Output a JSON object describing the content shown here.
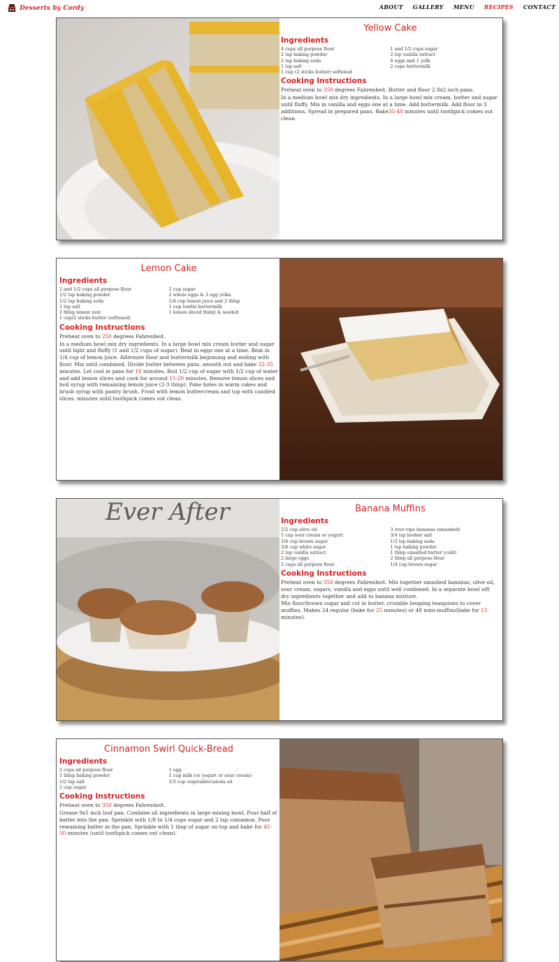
{
  "site": {
    "brand": "Desserts by Cordy",
    "brand_icon": "cake-icon"
  },
  "nav": [
    {
      "label": "ABOUT",
      "active": false
    },
    {
      "label": "GALLERY",
      "active": false
    },
    {
      "label": "MENU",
      "active": false
    },
    {
      "label": "RECIPES",
      "active": true
    },
    {
      "label": "CONTACT",
      "active": false
    }
  ],
  "colors": {
    "accent": "#d32222",
    "text": "#333333",
    "border": "#555555"
  },
  "ui": {
    "ingredients_heading": "Ingredients",
    "instructions_heading": "Cooking Instructions"
  },
  "recipes": [
    {
      "title": "Yellow Cake",
      "ingredients_col1": [
        "4 cups all purpose flour",
        "2 tsp baking powder",
        "2 tsp baking soda",
        "1 tsp salt",
        "1 cup (2 sticks butter) softened"
      ],
      "ingredients_col2": [
        "1 and 1/2 cups sugar",
        "2 tsp vanilla extract",
        "4 eggs and 1 yolk",
        "2 cups buttermilk"
      ],
      "steps": [
        [
          {
            "t": "Preheat oven to "
          },
          {
            "t": "350",
            "hl": true
          },
          {
            "t": " degrees Fahrenheit. Butter and flour 2 8x2 inch pans."
          }
        ],
        [
          {
            "t": "In a medium bowl mix dry ingredients. In a large bowl mix cream, butter and sugar until fluffy. Mix in vanilla and eggs one at a time. Add buttermilk. Add flour in 3 additions. Spread in prepared pans. Bake"
          },
          {
            "t": "35-40",
            "hl": true
          },
          {
            "t": " minutes until toothpick comes out clean."
          }
        ]
      ]
    },
    {
      "title": "Lemon Cake",
      "ingredients_col1": [
        "2 and 1/2 cups all purpose flour",
        "1/2 tsp baking powder",
        "1/2 tsp baking soda",
        "1 tsp salt",
        "2 tblsp lemon zest",
        "1 cup/2 sticks butter (softened)"
      ],
      "ingredients_col2": [
        "2 cup sugar",
        "2 whole eggs & 3 egg yolks",
        "1/4 cup lemon juice and 2 tblsp",
        "1 cup lowfat buttermilk",
        "1 lemon sliced thinly & seeded"
      ],
      "steps": [
        [
          {
            "t": "Preheat oven to "
          },
          {
            "t": "250",
            "hl": true
          },
          {
            "t": " degrees Fahrenheit."
          }
        ],
        [
          {
            "t": "In a medium bowl mix dry ingredients. In a large bowl mix cream butter and sugar until light and fluffy (1 and 1/2 cups of sugar). Beat in eggs one at a time. Beat in 1/4 cup of lemon juice. Alternate flour and buttermilk beginning and ending with flour. Mix until combined. Divide butter between pans, smooth out and bake "
          },
          {
            "t": "32-35",
            "hl": true
          },
          {
            "t": " minutes. Let cool in pans for "
          },
          {
            "t": "10",
            "hl": true
          },
          {
            "t": " minutes. Boil 1/2 cup of sugar with 1/2 cup of water and add lemon slices and cook for around "
          },
          {
            "t": "15-20",
            "hl": true
          },
          {
            "t": " minutes. Remove lemon slices and boil syrup with remaining lemon juice (2-3 tblsp). Poke holes in warm cakes and brush syrup with pastry brush. Frost with lemon buttercream and top with candied slices. minutes until toothpick comes out clean."
          }
        ]
      ]
    },
    {
      "title": "Banana Muffins",
      "ingredients_col1": [
        "1/2 cup olive oil",
        "1 cup sour cream or yogurt",
        "3/4 cup brown sugar",
        "3/4 cup white sugar",
        "2 tsp vanilla extract",
        "2 large eggs",
        "2 cups all purpose flour"
      ],
      "ingredients_col2": [
        "3 over-ripe bananas (smashed)",
        "3/4 tsp kosher salt",
        "1/2 tsp baking soda",
        "1 tsp baking powder",
        "1 tblsp unsalted butter (cold)",
        "2 tblsp all purpose flour",
        "1/4 cup brown sugar"
      ],
      "steps": [
        [
          {
            "t": "Preheat oven to "
          },
          {
            "t": "350",
            "hl": true
          },
          {
            "t": " degrees Fahrenheit. Mix together smashed bananas, olive oil, sour cream, sugars, vanilla and eggs until well combined. In a separate bowl sift dry ingredients together and add to banana mixture."
          }
        ],
        [
          {
            "t": "Mix flour/brown sugar and cut in butter, crumble heaping teaspoons to cover muffins. Makes 24 regular (bake for "
          },
          {
            "t": "25",
            "hl": true
          },
          {
            "t": " minutes) or 48 mini-muffins(bake for "
          },
          {
            "t": "15",
            "hl": true
          },
          {
            "t": " minutes)."
          }
        ]
      ]
    },
    {
      "title": "Cinnamon Swirl Quick-Bread",
      "ingredients_col1": [
        "2 cups all purpose flour",
        "1 tblsp baking powder",
        "1/2 tsp salt",
        "1 cup sugar"
      ],
      "ingredients_col2": [
        "1 egg",
        "1 cup milk (or yogurt or sour cream)",
        "1/3 cup vegetable/canola oil"
      ],
      "steps": [
        [
          {
            "t": "Preheat oven to "
          },
          {
            "t": "350",
            "hl": true
          },
          {
            "t": " degrees Fahrenheit."
          }
        ],
        [
          {
            "t": "Grease 9x5 inch loaf pan. Combine all ingredients in large mixing bowl. Pour half of batter into the pan. Sprinkle with 1/8 to 1/4 cups sugar and 2 tsp cinnamon. Pour remaining batter in the pan. Sprinkle with 1 tbsp of sugar on top and bake for "
          },
          {
            "t": "45-50",
            "hl": true
          },
          {
            "t": " minutes (until toothpick comes out clean)."
          }
        ]
      ]
    }
  ],
  "photos": {
    "muffin_sign_text": "Ever After"
  }
}
